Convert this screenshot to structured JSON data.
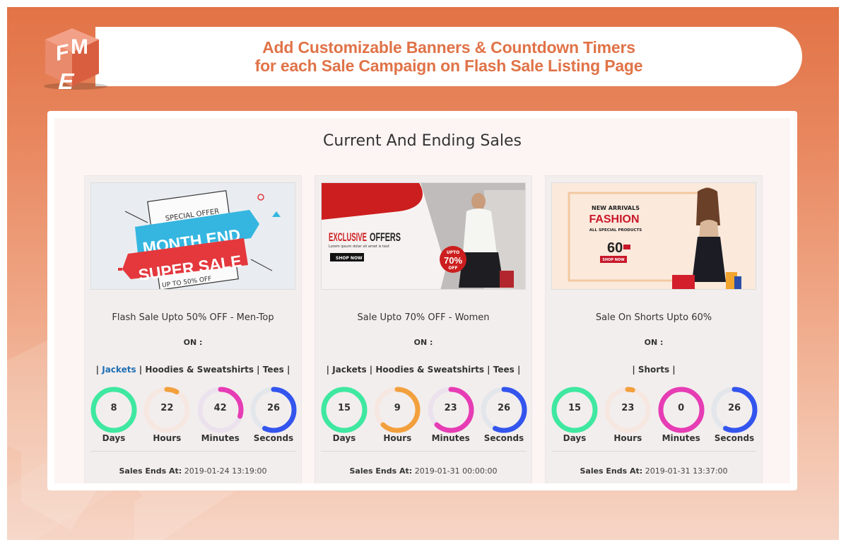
{
  "header": {
    "line1": "Add Customizable Banners & Countdown Timers",
    "line2": "for each Sale Campaign on Flash Sale Listing Page",
    "logo_letters": [
      "F",
      "M",
      "E"
    ]
  },
  "colors": {
    "accent_orange": "#e07348",
    "days": "#3fe8a0",
    "hours": "#f2a03d",
    "minutes": "#e63cb4",
    "seconds": "#3355ee",
    "link": "#1f6fb2"
  },
  "section": {
    "title": "Current And Ending Sales"
  },
  "labels": {
    "on": "ON :",
    "ends_prefix": "Sales Ends At:",
    "days": "Days",
    "hours": "Hours",
    "minutes": "Minutes",
    "seconds": "Seconds"
  },
  "cards": [
    {
      "title": "Flash Sale Upto 50% OFF - Men-Top",
      "banner": {
        "line1": "SPECIAL OFFER",
        "line2": "MONTH END",
        "line3": "SUPER SALE",
        "line4": "UP TO 50% OFF"
      },
      "categories": [
        "Jackets",
        "Hoodies & Sweatshirts",
        "Tees"
      ],
      "active_category": 0,
      "timer": {
        "days": 8,
        "hours": 22,
        "minutes": 42,
        "seconds": 26
      },
      "progress": {
        "days": 1.0,
        "hours": 0.08,
        "minutes": 0.3,
        "seconds": 0.57
      },
      "ends_at": "2019-01-24 13:19:00"
    },
    {
      "title": "Sale Upto 70% OFF - Women",
      "banner": {
        "line1": "EXCLUSIVE",
        "line2": "OFFERS",
        "line3": "Lorem ipsum dolar sit amet is text",
        "button": "SHOP NOW",
        "badge_top": "UPTO",
        "badge_mid": "70%",
        "badge_bot": "OFF"
      },
      "categories": [
        "Jackets",
        "Hoodies & Sweatshirts",
        "Tees"
      ],
      "active_category": -1,
      "timer": {
        "days": 15,
        "hours": 9,
        "minutes": 23,
        "seconds": 26
      },
      "progress": {
        "days": 1.0,
        "hours": 0.62,
        "minutes": 0.62,
        "seconds": 0.57
      },
      "ends_at": "2019-01-31 00:00:00"
    },
    {
      "title": "Sale On Shorts Upto 60%",
      "banner": {
        "line1": "NEW ARRIVALS",
        "line2": "FASHION",
        "line3": "ALL SPECIAL PRODUCTS",
        "discount": "60",
        "button": "SHOP NOW"
      },
      "categories": [
        "Shorts"
      ],
      "active_category": -1,
      "timer": {
        "days": 15,
        "hours": 23,
        "minutes": 0,
        "seconds": 26
      },
      "progress": {
        "days": 1.0,
        "hours": 0.04,
        "minutes": 1.0,
        "seconds": 0.57
      },
      "ends_at": "2019-01-31 13:37:00"
    }
  ]
}
